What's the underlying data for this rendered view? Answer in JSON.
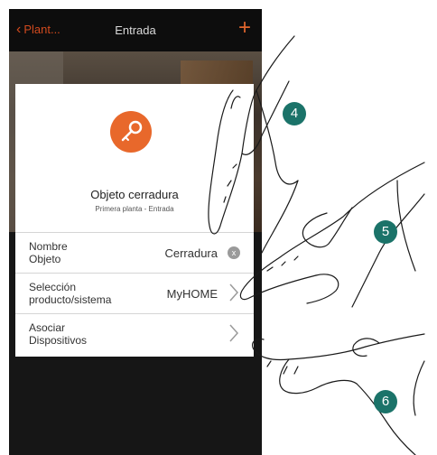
{
  "header": {
    "back_label": "Plant...",
    "title": "Entrada",
    "add_label": "+"
  },
  "object": {
    "name": "Objeto cerradura",
    "location": "Primera planta - Entrada"
  },
  "rows": [
    {
      "label": "Nombre\nObjeto",
      "value": "Cerradura",
      "clear_label": "x"
    },
    {
      "label": "Selección\nproducto/sistema",
      "value": "MyHOME"
    },
    {
      "label": "Asociar\nDispositivos",
      "value": ""
    }
  ],
  "callouts": [
    "4",
    "5",
    "6"
  ],
  "colors": {
    "accent": "#e0652d",
    "badge": "#1b7369"
  }
}
